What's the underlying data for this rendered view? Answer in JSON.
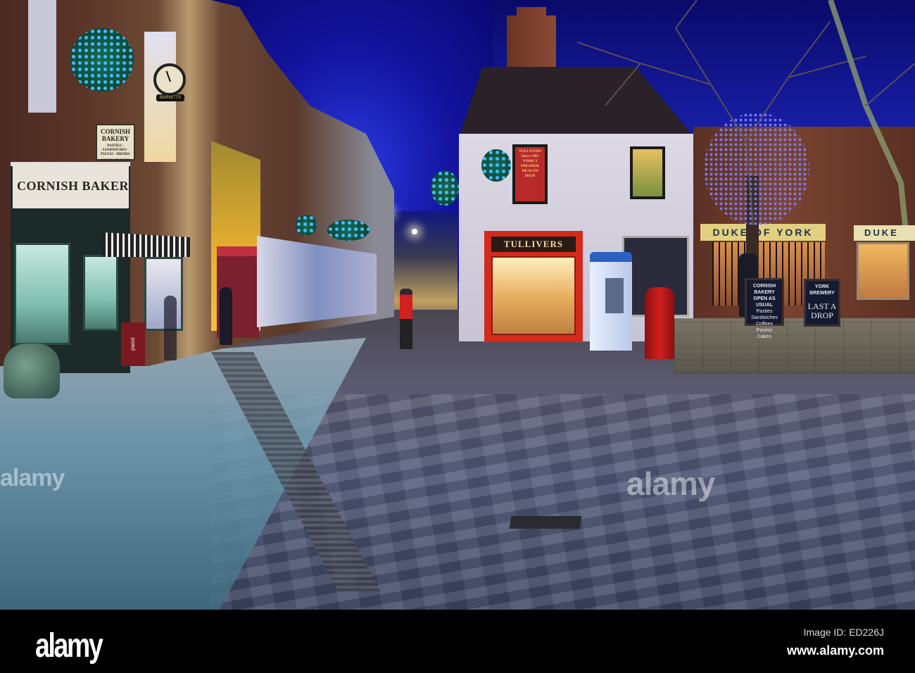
{
  "scene": {
    "bakery_fascia": "CORNISH BAKERY",
    "bakery_hanging_sign": {
      "title": "CORNISH BAKERY",
      "subtitle": "PASTIES · SANDWICHES · PIZZAS · DRINKS",
      "footer": "EAT IN OR TAKE AWAY"
    },
    "clock_label": "BARNITTS",
    "pavement_sign": "passi",
    "health_shop_sign": [
      "TULLIVERS",
      "Since 1985",
      "YORK'S",
      "PREMIER",
      "HEALTH",
      "SHOP"
    ],
    "tullivers_fascia": "TULLIVERS",
    "pub_fascia": "DUKE OF YORK",
    "pub_fascia_2": "DUKE",
    "board_bakery": {
      "title": "CORNISH BAKERY",
      "subtitle": "OPEN AS USUAL",
      "items": [
        "Pasties",
        "Sandwiches",
        "Coffees",
        "Paninis",
        "Cakes"
      ]
    },
    "board_pub": {
      "title": "YORK BREWERY",
      "headline": "LAST A DROP"
    },
    "watermark": "alamy"
  },
  "footer": {
    "logo": "alamy",
    "image_id": "Image ID: ED226J",
    "website": "www.alamy.com"
  }
}
